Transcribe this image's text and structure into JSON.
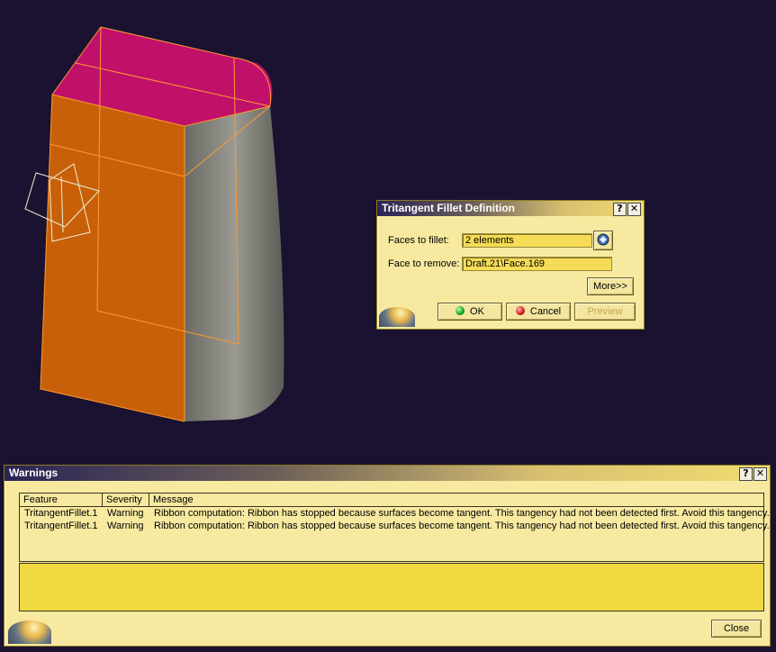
{
  "fillet_dialog": {
    "title": "Tritangent Fillet Definition",
    "help_label": "?",
    "close_label": "✕",
    "faces_to_fillet_label": "Faces to fillet:",
    "faces_to_fillet_value": "2 elements",
    "face_to_remove_label": "Face to remove:",
    "face_to_remove_value": "Draft.21\\Face.169",
    "more_label": "More>>",
    "ok_label": "OK",
    "cancel_label": "Cancel",
    "preview_label": "Preview"
  },
  "warnings": {
    "title": "Warnings",
    "help_label": "?",
    "close_x_label": "✕",
    "columns": [
      "Feature",
      "Severity",
      "Message"
    ],
    "rows": [
      {
        "feature": "TritangentFillet.1",
        "severity": "Warning",
        "message": "Ribbon computation: Ribbon has stopped because surfaces become tangent. This tangency had not been detected first. Avoid this tangency."
      },
      {
        "feature": "TritangentFillet.1",
        "severity": "Warning",
        "message": "Ribbon computation: Ribbon has stopped because surfaces become tangent. This tangency had not been detected first. Avoid this tangency."
      }
    ],
    "close_label": "Close"
  },
  "colors": {
    "background": "#1a1230",
    "part_face": "#c8600a",
    "top_face": "#c0106a",
    "selection_edge": "#ff9a30",
    "cylinder": "#8a8a82"
  },
  "icons": [
    "face-selector-icon",
    "ok-green-icon",
    "cancel-red-icon",
    "compass-globe-icon",
    "axis-system-icon"
  ]
}
